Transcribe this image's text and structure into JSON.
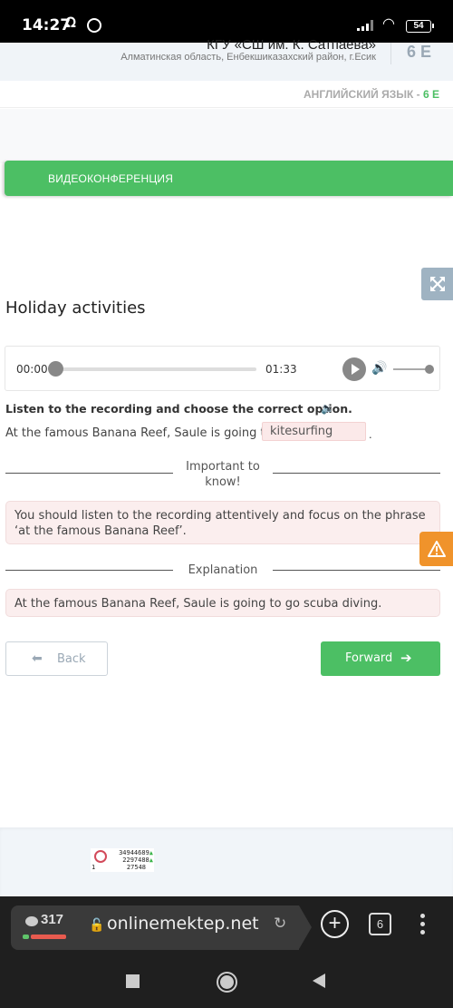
{
  "status_bar": {
    "time": "14:27",
    "battery": "54",
    "icons": [
      "headset-icon",
      "whatsapp-icon",
      "signal-icon",
      "wifi-icon",
      "battery-icon"
    ]
  },
  "school": {
    "name": "КГУ «СШ им. К. Сатпаева»",
    "address": "Алматинская область, Енбекшиказахский район, г.Есик",
    "class": "6 Е"
  },
  "subject": {
    "name": "АНГЛИЙСКИЙ ЯЗЫК - ",
    "class": "6 Е"
  },
  "video_bar": {
    "label": "ВИДЕОКОНФЕРЕНЦИЯ"
  },
  "lesson": {
    "title": "Holiday activities"
  },
  "audio_player": {
    "current_time": "00:00",
    "duration": "01:33",
    "progress": 0,
    "volume": 1.0
  },
  "exercise": {
    "instruction": "Listen to the recording and choose the correct option.",
    "sentence_prefix": "At the famous Banana Reef, Saule is going to go",
    "answer_value": "kitesurfing",
    "sentence_suffix": "."
  },
  "important": {
    "label_line1": "Important to",
    "label_line2": "know!",
    "text": "You should listen to the recording attentively and focus on the phrase ‘at the famous Banana Reef’."
  },
  "explanation": {
    "label": "Explanation",
    "text": "At the famous Banana Reef, Saule is going to go scuba diving."
  },
  "navigation": {
    "back_label": "Back",
    "forward_label": "Forward"
  },
  "counter_widget": {
    "left_num": "1",
    "rows": [
      "34944689",
      "2297488",
      "27548"
    ]
  },
  "browser": {
    "chat_count": "317",
    "url": "onlinemektep.net",
    "tabs_count": "6"
  },
  "colors": {
    "accent_green": "#4cbf64",
    "warning_orange": "#f0932b",
    "note_bg": "#fbeeee",
    "expand_bg": "#9fb3c2"
  }
}
